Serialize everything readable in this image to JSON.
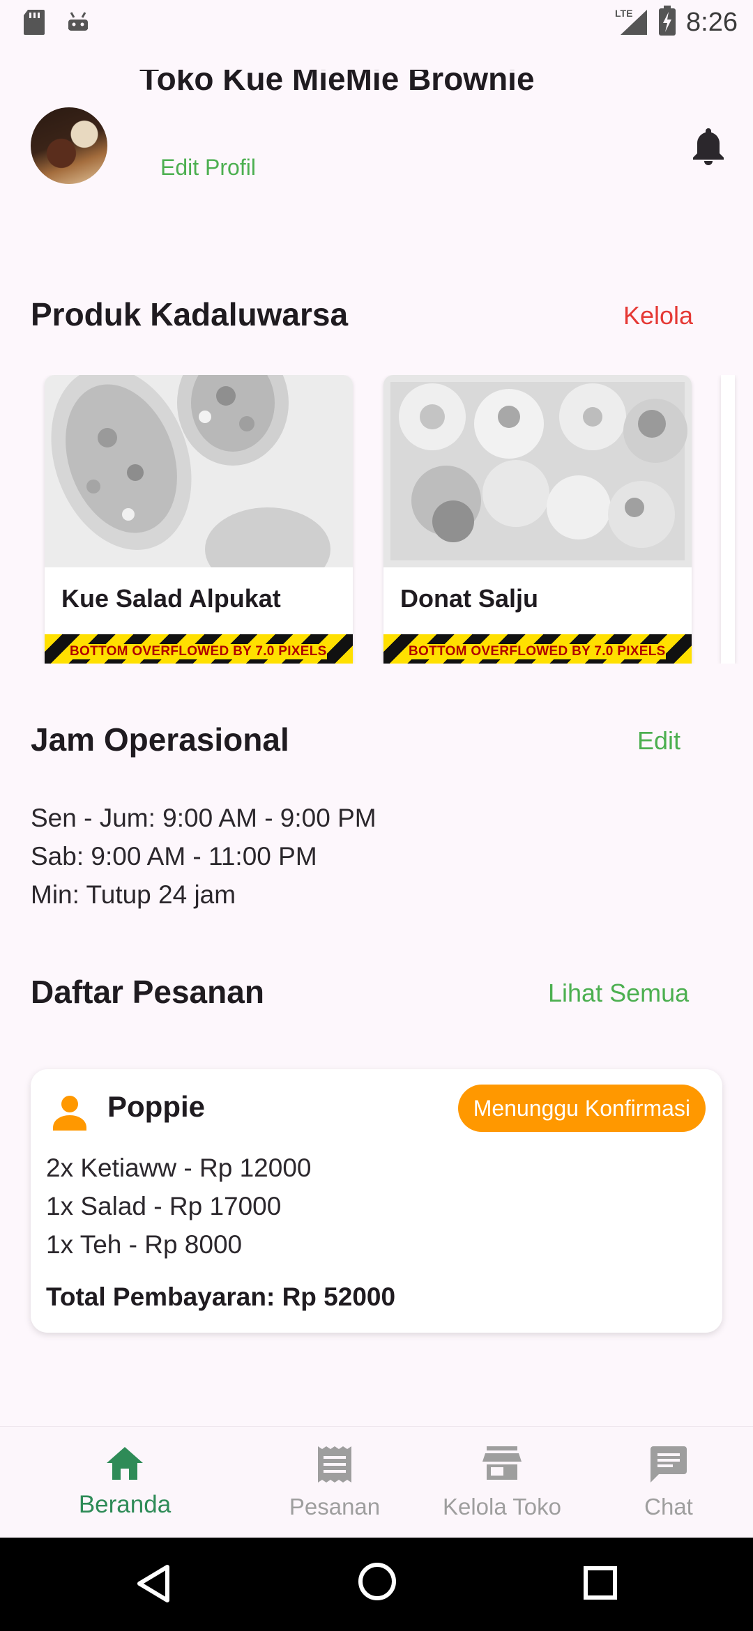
{
  "status_bar": {
    "time": "8:26",
    "network": "LTE",
    "icons": [
      "sd-card-icon",
      "android-icon",
      "lte-signal-icon",
      "battery-charging-icon"
    ]
  },
  "header": {
    "store_name": "Toko Kue MieMie Brownie",
    "edit_profile_label": "Edit Profil",
    "icons": [
      "avatar",
      "bell-icon"
    ]
  },
  "expired_products": {
    "title": "Produk Kadaluwarsa",
    "action_label": "Kelola",
    "action_color": "#e53935",
    "items": [
      {
        "name": "Kue Salad Alpukat",
        "overflow_warning": "BOTTOM OVERFLOWED BY 7.0 PIXELS"
      },
      {
        "name": "Donat Salju",
        "overflow_warning": "BOTTOM OVERFLOWED BY 7.0 PIXELS"
      }
    ]
  },
  "operating_hours": {
    "title": "Jam Operasional",
    "action_label": "Edit",
    "action_color": "#4caf50",
    "lines": [
      "Sen - Jum: 9:00 AM - 9:00 PM",
      "Sab: 9:00 AM - 11:00 PM",
      "Min: Tutup 24 jam"
    ]
  },
  "orders": {
    "title": "Daftar Pesanan",
    "action_label": "Lihat Semua",
    "action_color": "#4caf50",
    "list": [
      {
        "customer": "Poppie",
        "status": "Menunggu Konfirmasi",
        "status_color": "#ff9800",
        "items": [
          "2x Ketiaww - Rp 12000",
          "1x Salad - Rp 17000",
          "1x Teh - Rp 8000"
        ],
        "total": "Total Pembayaran: Rp 52000"
      }
    ]
  },
  "bottom_nav": {
    "active_color": "#2e8b57",
    "inactive_color": "#9e9e9e",
    "items": [
      {
        "label": "Beranda",
        "icon": "home-icon",
        "active": true
      },
      {
        "label": "Pesanan",
        "icon": "receipt-icon",
        "active": false
      },
      {
        "label": "Kelola Toko",
        "icon": "store-icon",
        "active": false
      },
      {
        "label": "Chat",
        "icon": "chat-icon",
        "active": false
      }
    ]
  },
  "system_nav": [
    "back-icon",
    "home-circle-icon",
    "recents-icon"
  ]
}
